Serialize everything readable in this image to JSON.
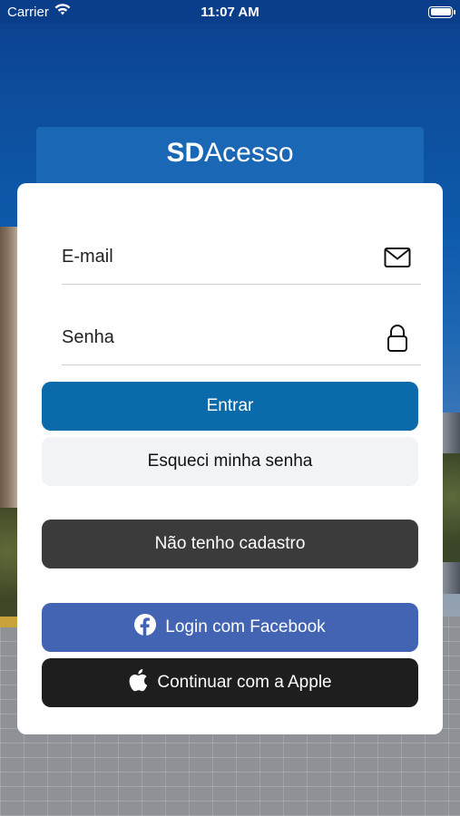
{
  "status_bar": {
    "carrier": "Carrier",
    "time": "11:07 AM"
  },
  "header": {
    "title_bold": "SD",
    "title_rest": "Acesso"
  },
  "form": {
    "email_placeholder": "E-mail",
    "password_placeholder": "Senha",
    "login_label": "Entrar",
    "forgot_label": "Esqueci minha senha",
    "register_label": "Não tenho cadastro",
    "facebook_label": "Login com Facebook",
    "apple_label": "Continuar com a Apple"
  },
  "icons": {
    "wifi": "wifi-icon",
    "battery": "battery-icon",
    "email": "envelope-icon",
    "password": "lock-icon",
    "facebook": "facebook-icon",
    "apple": "apple-icon"
  },
  "colors": {
    "primary": "#0a6aaa",
    "header": "#1a67b5",
    "facebook": "#4264b3",
    "apple": "#1e1e1e",
    "dark": "#3b3b3b",
    "light": "#f1f3f6"
  }
}
